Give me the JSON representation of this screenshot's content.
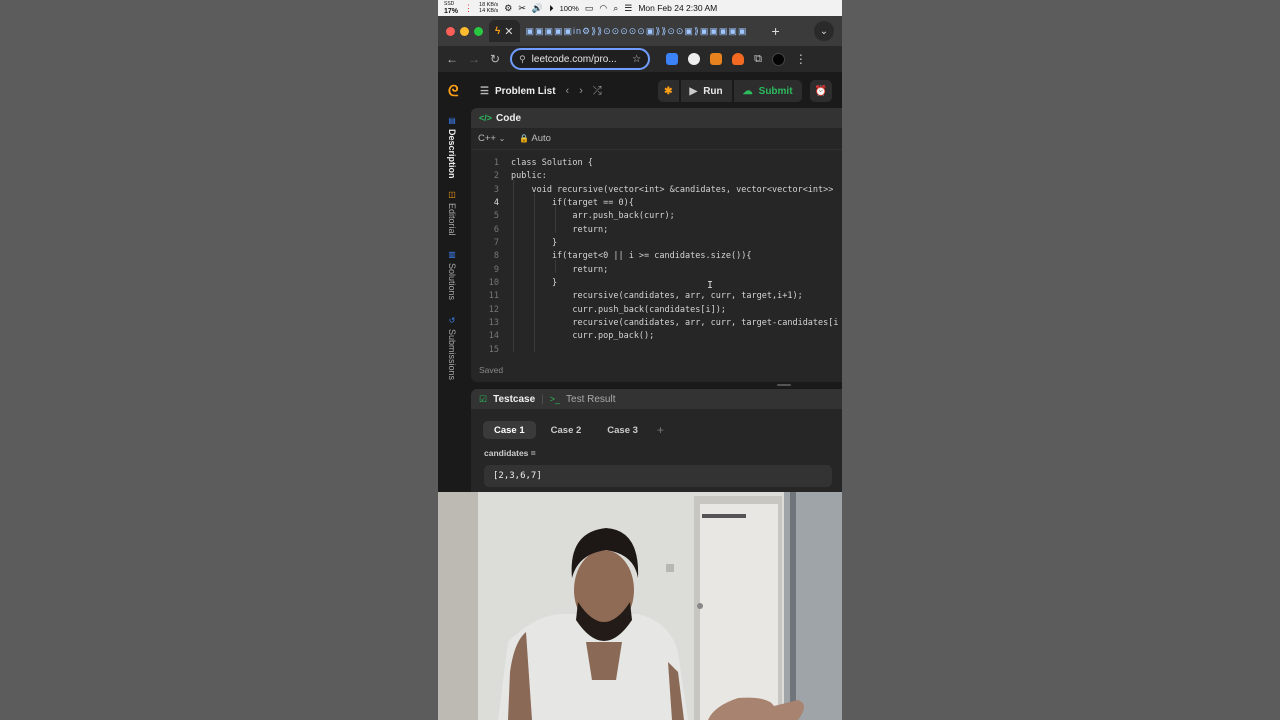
{
  "menubar": {
    "ssd_label": "SSD",
    "ssd_value": "17%",
    "net_up": "18 KB/s",
    "net_down": "14 KB/s",
    "battery": "100%",
    "clock": "Mon Feb 24  2:30 AM"
  },
  "browser": {
    "url": "leetcode.com/pro..."
  },
  "header": {
    "problem_list": "Problem List",
    "run": "Run",
    "submit": "Submit"
  },
  "sidebar": {
    "items": [
      {
        "label": "Description"
      },
      {
        "label": "Editorial"
      },
      {
        "label": "Solutions"
      },
      {
        "label": "Submissions"
      }
    ]
  },
  "editor": {
    "title": "Code",
    "language": "C++",
    "mode": "Auto",
    "status": "Saved",
    "line_numbers": [
      "1",
      "2",
      "3",
      "4",
      "5",
      "6",
      "7",
      "8",
      "9",
      "10",
      "11",
      "12",
      "13",
      "14",
      "15"
    ],
    "current_line": 4,
    "lines": [
      "class Solution {",
      "public:",
      "    void recursive(vector<int> &candidates, vector<vector<int>>",
      "        if(target == 0){",
      "            arr.push_back(curr);",
      "            return;",
      "        }",
      "        if(target<0 || i >= candidates.size()){",
      "            return;",
      "        }",
      "            recursive(candidates, arr, curr, target,i+1);",
      "            curr.push_back(candidates[i]);",
      "            recursive(candidates, arr, curr, target-candidates[i",
      "            curr.pop_back();",
      ""
    ]
  },
  "testcase": {
    "tab_label": "Testcase",
    "result_label": "Test Result",
    "cases": [
      "Case 1",
      "Case 2",
      "Case 3"
    ],
    "selected_case": 0,
    "variable_label": "candidates =",
    "variable_value": "[2,3,6,7]"
  },
  "colors": {
    "brand": "#ffa116",
    "submit": "#2cbb5d",
    "panel_bg": "#262626",
    "page_bg": "#1a1a1a"
  },
  "icons": {
    "logo": "leetcode-logo-icon",
    "run": "play-icon",
    "submit": "cloud-upload-icon"
  }
}
